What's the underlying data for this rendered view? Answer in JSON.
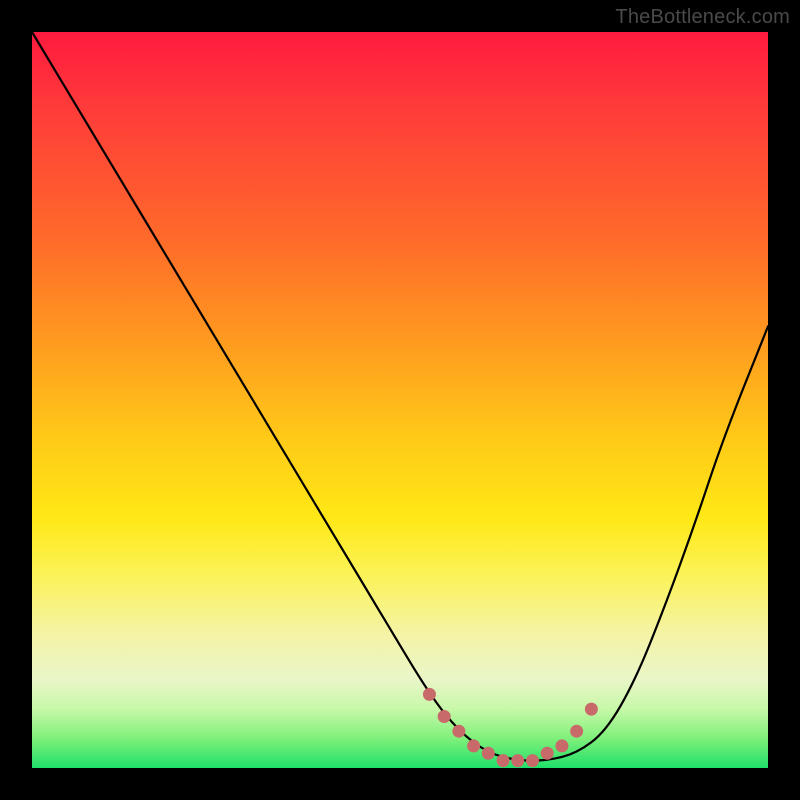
{
  "watermark": "TheBottleneck.com",
  "colors": {
    "frame": "#000000",
    "curve": "#000000",
    "dots": "#c96a6a"
  },
  "chart_data": {
    "type": "line",
    "title": "",
    "xlabel": "",
    "ylabel": "",
    "xlim": [
      0,
      100
    ],
    "ylim": [
      0,
      100
    ],
    "grid": false,
    "legend": false,
    "series": [
      {
        "name": "bottleneck-curve",
        "x": [
          0,
          6,
          12,
          18,
          24,
          30,
          36,
          42,
          48,
          54,
          58,
          62,
          66,
          70,
          74,
          78,
          82,
          86,
          90,
          94,
          100
        ],
        "values": [
          100,
          90,
          80,
          70,
          60,
          50,
          40,
          30,
          20,
          10,
          5,
          2,
          1,
          1,
          2,
          5,
          12,
          22,
          33,
          45,
          60
        ]
      }
    ],
    "annotations": {
      "dots_x": [
        54,
        56,
        58,
        60,
        62,
        64,
        66,
        68,
        70,
        72,
        74,
        76
      ],
      "dots_y": [
        10,
        7,
        5,
        3,
        2,
        1,
        1,
        1,
        2,
        3,
        5,
        8
      ]
    }
  }
}
